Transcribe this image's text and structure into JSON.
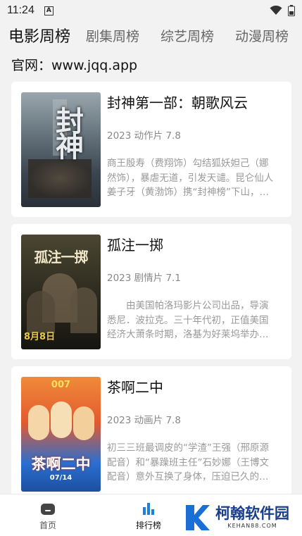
{
  "status": {
    "time": "11:24",
    "notif": "A"
  },
  "tabs": [
    "电影周榜",
    "剧集周榜",
    "综艺周榜",
    "动漫周榜"
  ],
  "site": "官网：www.jqq.app",
  "movies": [
    {
      "title": "封神第一部：朝歌风云",
      "meta": "2023 动作片 7.8",
      "desc": "商王殷寿（费翔饰）勾结狐妖妲己（娜然饰），暴虐无道，引发天谴。昆仑仙人姜子牙（黄渤饰）携“封神榜”下山，寻找天下共主，以救苍生。西伯侯之子姬发（于适饰）逐渐发现殷寿的本来面目……",
      "poster_text": "封神",
      "poster_colors": [
        "#6f7d86",
        "#3b4650",
        "#c9cfd2"
      ]
    },
    {
      "title": "孤注一掷",
      "meta": "2023 剧情片 7.1",
      "desc": "由美国帕洛玛影片公司出品，导演悉尼．波拉克。三十年代初，正值美国经济大萧条时期，洛基为好莱坞举办百对舞蹈选手马拉松大赛，在这些选手中有失业的大学生……",
      "poster_text": "孤注一掷",
      "poster_sub": "8月8日",
      "poster_colors": [
        "#3a3a2c",
        "#1b1b14",
        "#d8c25a"
      ]
    },
    {
      "title": "茶啊二中",
      "meta": "2023 动画片 7.8",
      "desc": "初三三班最调皮的“学渣”王强（邢原源配音）和“暴躁班主任”石妙娜（王博文配音）意外互换了身体，压迫已久的王强过了一把当班主任的瘾，石妙娜也……",
      "poster_text": "茶啊二中",
      "poster_sub": "07/14",
      "poster_colors": [
        "#e8743a",
        "#2a6fd1",
        "#f2c84a"
      ]
    }
  ],
  "nav": {
    "home": "首页",
    "rank": "排行榜"
  },
  "watermark": {
    "cn": "柯翰软件园",
    "en": "KEHAN88.COM"
  }
}
